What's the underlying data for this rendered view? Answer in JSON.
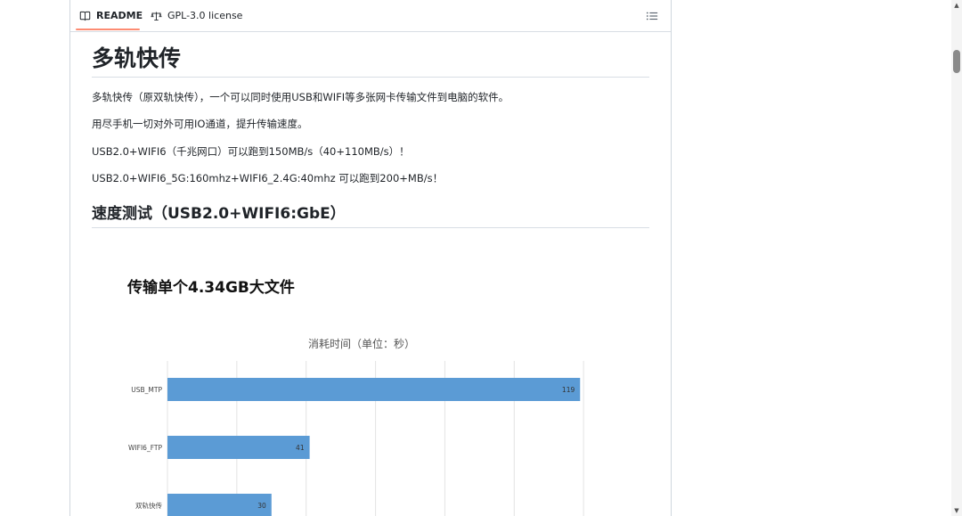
{
  "tabs": {
    "readme_label": "README",
    "license_label": "GPL-3.0 license"
  },
  "readme": {
    "title": "多轨快传",
    "paragraphs": [
      "多轨快传（原双轨快传），一个可以同时使用USB和WIFI等多张网卡传输文件到电脑的软件。",
      "用尽手机一切对外可用IO通道，提升传输速度。",
      "USB2.0+WIFI6（千兆网口）可以跑到150MB/s（40+110MB/s）！",
      "USB2.0+WIFI6_5G:160mhz+WIFI6_2.4G:40mhz 可以跑到200+MB/s！"
    ],
    "section_title": "速度测试（USB2.0+WIFI6:GbE）"
  },
  "chart_heading": "传输单个4.34GB大文件",
  "chart_data": {
    "type": "bar",
    "orientation": "horizontal",
    "title": "消耗时间（单位：秒）",
    "categories": [
      "USB_MTP",
      "WIFI6_FTP",
      "双轨快传"
    ],
    "values": [
      119,
      41,
      30
    ],
    "xlim": [
      0,
      140
    ],
    "grid": true,
    "bar_color": "#5b9bd5"
  },
  "icons": {
    "readme": "book-icon",
    "license": "scale-icon",
    "outline": "list-icon"
  }
}
